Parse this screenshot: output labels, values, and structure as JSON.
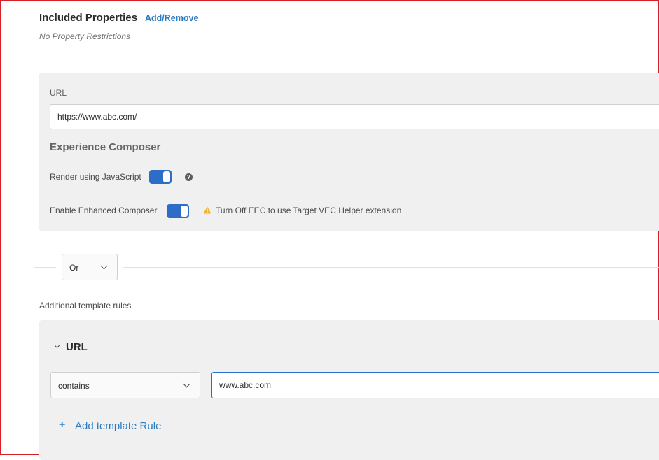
{
  "header": {
    "title": "Included Properties",
    "add_remove_link": "Add/Remove",
    "subtitle": "No Property Restrictions"
  },
  "url_section": {
    "label": "URL",
    "value": "https://www.abc.com/"
  },
  "experience_composer": {
    "heading": "Experience Composer",
    "render_js_label": "Render using JavaScript",
    "render_js_enabled": true,
    "enhanced_label": "Enable Enhanced Composer",
    "enhanced_enabled": true,
    "warning_text": "Turn Off EEC to use Target VEC Helper extension"
  },
  "operator": {
    "selected": "Or"
  },
  "additional_rules": {
    "label": "Additional template rules",
    "rule_heading": "URL",
    "condition_selected": "contains",
    "condition_value": "www.abc.com",
    "add_rule_label": "Add template Rule",
    "add_rule_icon": "+"
  },
  "icons": {
    "help": "?",
    "warning_color": "#f2b32a",
    "accent": "#2c6ec7",
    "link": "#2b7bc0"
  }
}
